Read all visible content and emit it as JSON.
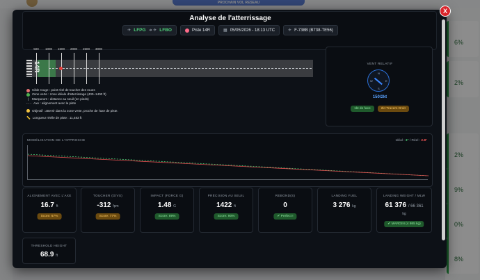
{
  "background": {
    "banner_text": "PROCHAIN VOL RESEAU",
    "right_cards": [
      "6%",
      "2%",
      "2%",
      "9%",
      "0%",
      "8%"
    ]
  },
  "modal": {
    "title": "Analyse de l'atterrissage",
    "close_label": "X",
    "departure": "LFPG",
    "arrival": "LFBO",
    "runway": "Piste 14R",
    "datetime": "05/05/2026 - 18:13 UTC",
    "aircraft": "F-738B (B738-TE56)"
  },
  "runway_view": {
    "runway_number": "14R",
    "distance_ticks": [
      "500",
      "1000",
      "1500",
      "2000",
      "2500",
      "3000"
    ],
    "legend": [
      {
        "icon": "red",
        "text": "Cible rouge : point réel de toucher des roues"
      },
      {
        "icon": "green",
        "text": "Zone verte : zone idéale d'atterrissage (400–1400 ft)"
      },
      {
        "icon": "bar",
        "text": "Marqueurs : distance au seuil (en pieds)"
      },
      {
        "icon": "dash",
        "text": "Axe : alignement avec la piste"
      }
    ],
    "objective": "Objectif : atterrir dans la zone verte, proche de l'axe de piste.",
    "runway_length": "Longueur réelle de piste : 11,483 ft"
  },
  "wind": {
    "title": "VENT RELATIF",
    "value": "150/2kt",
    "headwind": "1kt de face",
    "crosswind": "2kt Travers Droit",
    "compass": {
      "n": "N",
      "e": "E",
      "s": "S",
      "w": "W"
    }
  },
  "approach": {
    "title": "MODÉLISATION DE L'APPROCHE",
    "ideal_label": "Idéal :",
    "ideal_value": "3°",
    "real_label": "/ Réel :",
    "real_value": "2.8°"
  },
  "metrics": [
    {
      "label": "ALIGNEMENT AVEC L'AXE",
      "value": "16.7",
      "unit": "ft",
      "badge": "Score: 67%",
      "badge_color": "orange"
    },
    {
      "label": "TOUCHER (G/VS)",
      "value": "-312",
      "unit": "fpm",
      "badge": "Score: 77%",
      "badge_color": "orange"
    },
    {
      "label": "IMPACT (FORCE G)",
      "value": "1.48",
      "unit": "G",
      "badge": "Score: 89%",
      "badge_color": "green"
    },
    {
      "label": "PRÉCISION AU SEUIL",
      "value": "1422",
      "unit": "ft",
      "badge": "Score: 90%",
      "badge_color": "green"
    },
    {
      "label": "REBOND(S)",
      "value": "0",
      "unit": "",
      "badge": "Perfect !",
      "badge_color": "green"
    },
    {
      "label": "LANDING FUEL",
      "value": "3 276",
      "unit": "kg",
      "badge": "",
      "badge_color": ""
    },
    {
      "label": "LANDING WEIGHT / MLW",
      "value": "61 376",
      "sub": "/ 66 361",
      "unit": "kg",
      "badge": "MARGIN (4 985 kg)",
      "badge_color": "green"
    },
    {
      "label": "THRESHOLD HEIGHT",
      "value": "68.9",
      "unit": "ft",
      "badge": "",
      "badge_color": ""
    }
  ]
}
